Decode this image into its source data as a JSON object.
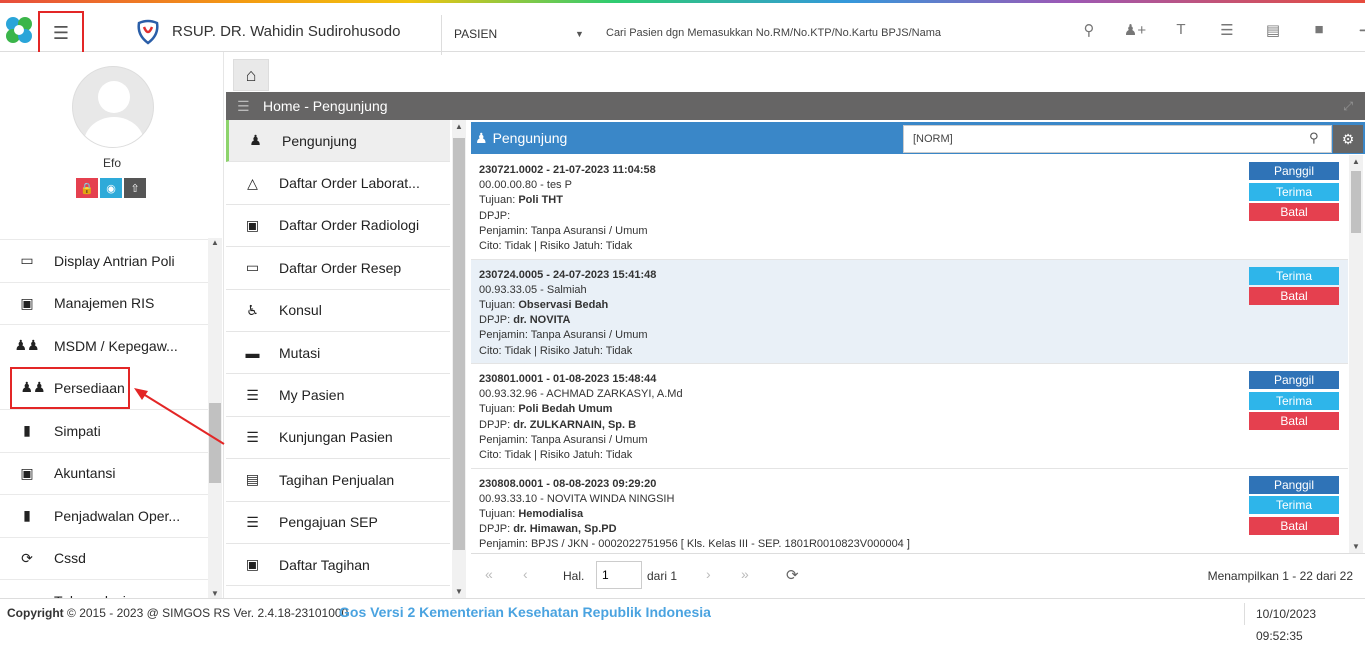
{
  "header": {
    "hospital_name": "RSUP. DR. Wahidin Sudirohusodo",
    "search_type": "PASIEN",
    "search_placeholder": "Cari Pasien dgn Memasukkan No.RM/No.KTP/No.Kartu BPJS/Nama",
    "toolbar_icons": [
      "search-icon",
      "add-user-icon",
      "text-icon",
      "list-icon",
      "pdf-icon",
      "folder-icon",
      "logout-icon"
    ]
  },
  "user": {
    "name": "Efo"
  },
  "sidebar": {
    "items": [
      {
        "label": "Display Antrian Poli",
        "icon": "monitor-icon"
      },
      {
        "label": "Manajemen RIS",
        "icon": "xray-icon"
      },
      {
        "label": "MSDM / Kepegaw...",
        "icon": "users-icon"
      },
      {
        "label": "Persediaan",
        "icon": "users-icon"
      },
      {
        "label": "Simpati",
        "icon": "book-icon"
      },
      {
        "label": "Akuntansi",
        "icon": "money-icon"
      },
      {
        "label": "Penjadwalan Oper...",
        "icon": "book-icon"
      },
      {
        "label": "Cssd",
        "icon": "refresh-icon"
      },
      {
        "label": "Tuberculosis",
        "icon": "circle-icon"
      }
    ]
  },
  "panel": {
    "title": "Home - Pengunjung"
  },
  "submenu": {
    "items": [
      {
        "label": "Pengunjung",
        "icon": "user-icon"
      },
      {
        "label": "Daftar Order Laborat...",
        "icon": "flask-icon"
      },
      {
        "label": "Daftar Order Radiologi",
        "icon": "xray-icon"
      },
      {
        "label": "Daftar Order Resep",
        "icon": "eraser-icon"
      },
      {
        "label": "Konsul",
        "icon": "wheelchair-icon"
      },
      {
        "label": "Mutasi",
        "icon": "bed-icon"
      },
      {
        "label": "My Pasien",
        "icon": "list-icon"
      },
      {
        "label": "Kunjungan Pasien",
        "icon": "list-icon"
      },
      {
        "label": "Tagihan Penjualan",
        "icon": "card-icon"
      },
      {
        "label": "Pengajuan SEP",
        "icon": "list-icon"
      },
      {
        "label": "Daftar Tagihan",
        "icon": "money-icon"
      }
    ]
  },
  "list": {
    "title": "Pengunjung",
    "filter_value": "[NORM]",
    "records": [
      {
        "line1": "230721.0002 - 21-07-2023 11:04:58",
        "line2": "00.00.00.80 - tes P",
        "tujuan_label": "Tujuan: ",
        "tujuan": "Poli THT",
        "dpjp_label": "DPJP:",
        "dpjp": "",
        "penjamin": "Penjamin: Tanpa Asuransi / Umum",
        "cito": "Cito: Tidak | Risiko Jatuh: Tidak",
        "buttons": [
          "Panggil",
          "Terima",
          "Batal"
        ]
      },
      {
        "line1": "230724.0005 - 24-07-2023 15:41:48",
        "line2": "00.93.33.05 - Salmiah",
        "tujuan_label": "Tujuan: ",
        "tujuan": "Observasi Bedah",
        "dpjp_label": "DPJP: ",
        "dpjp": "dr. NOVITA",
        "penjamin": "Penjamin: Tanpa Asuransi / Umum",
        "cito": "Cito: Tidak | Risiko Jatuh: Tidak",
        "buttons": [
          "Terima",
          "Batal"
        ]
      },
      {
        "line1": "230801.0001 - 01-08-2023 15:48:44",
        "line2": "00.93.32.96 - ACHMAD ZARKASYI, A.Md",
        "tujuan_label": "Tujuan: ",
        "tujuan": "Poli Bedah Umum",
        "dpjp_label": "DPJP: ",
        "dpjp": "dr. ZULKARNAIN, Sp. B",
        "penjamin": "Penjamin: Tanpa Asuransi / Umum",
        "cito": "Cito: Tidak | Risiko Jatuh: Tidak",
        "buttons": [
          "Panggil",
          "Terima",
          "Batal"
        ]
      },
      {
        "line1": "230808.0001 - 08-08-2023 09:29:20",
        "line2": "00.93.33.10 - NOVITA WINDA NINGSIH",
        "tujuan_label": "Tujuan: ",
        "tujuan": "Hemodialisa",
        "dpjp_label": "DPJP: ",
        "dpjp": "dr. Himawan, Sp.PD",
        "penjamin": "Penjamin: BPJS / JKN - 0002022751956 [ Kls. Kelas III - SEP. 1801R0010823V000004 ]",
        "cito": "",
        "buttons": [
          "Panggil",
          "Terima",
          "Batal"
        ]
      }
    ]
  },
  "pager": {
    "hal_label": "Hal.",
    "page": "1",
    "dari_label": "dari 1",
    "info": "Menampilkan 1 - 22 dari 22"
  },
  "footer": {
    "copyright_label": "Copyright",
    "copyright_text": "2015 - 2023 @ SIMGOS RS Ver. 2.4.18-23101000",
    "marquee": "Gos Versi 2 Kementerian Kesehatan Republik Indonesia",
    "clock": "10/10/2023 09:52:35"
  },
  "colors": {
    "accent": "#3a87c8",
    "highlight": "#e32626",
    "panel": "#666565"
  }
}
